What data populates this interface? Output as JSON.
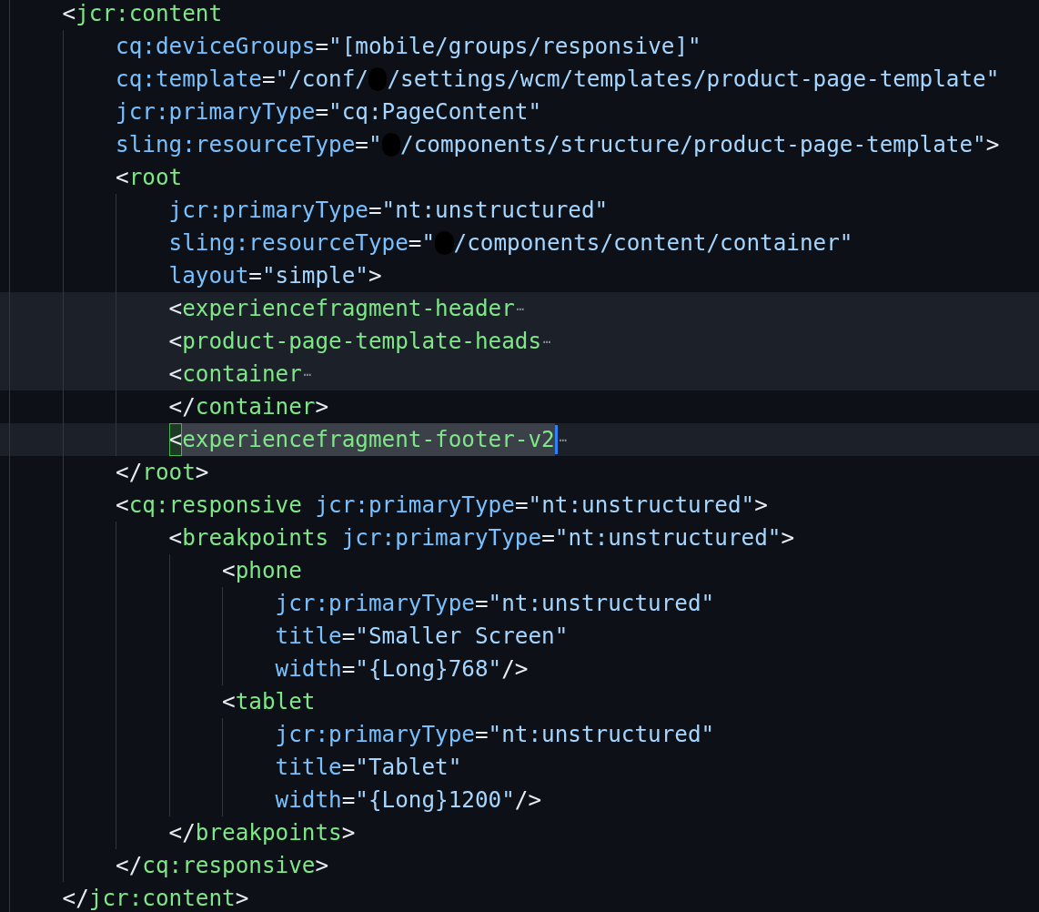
{
  "editor": {
    "lines": [
      {
        "highlighted": false,
        "tokens": [
          {
            "kind": "punct",
            "text": "<"
          },
          {
            "kind": "tag",
            "text": "jcr:content"
          }
        ],
        "children": [
          {
            "highlighted": false,
            "tokens": [
              {
                "kind": "attr",
                "text": "cq:deviceGroups"
              },
              {
                "kind": "punct",
                "text": "="
              },
              {
                "kind": "value",
                "text": "\"[mobile/groups/responsive]\""
              }
            ]
          },
          {
            "highlighted": false,
            "tokens": [
              {
                "kind": "attr",
                "text": "cq:template"
              },
              {
                "kind": "punct",
                "text": "="
              },
              {
                "kind": "value",
                "text": "\"/conf/"
              },
              {
                "kind": "redacted"
              },
              {
                "kind": "value",
                "text": "/settings/wcm/templates/product-page-template\""
              }
            ]
          },
          {
            "highlighted": false,
            "tokens": [
              {
                "kind": "attr",
                "text": "jcr:primaryType"
              },
              {
                "kind": "punct",
                "text": "="
              },
              {
                "kind": "value",
                "text": "\"cq:PageContent\""
              }
            ]
          },
          {
            "highlighted": false,
            "tokens": [
              {
                "kind": "attr",
                "text": "sling:resourceType"
              },
              {
                "kind": "punct",
                "text": "="
              },
              {
                "kind": "value",
                "text": "\""
              },
              {
                "kind": "redacted"
              },
              {
                "kind": "value",
                "text": "/components/structure/product-page-template\""
              },
              {
                "kind": "punct",
                "text": ">"
              }
            ]
          },
          {
            "highlighted": false,
            "tokens": [
              {
                "kind": "punct",
                "text": "<"
              },
              {
                "kind": "tag",
                "text": "root"
              }
            ],
            "children": [
              {
                "highlighted": false,
                "tokens": [
                  {
                    "kind": "attr",
                    "text": "jcr:primaryType"
                  },
                  {
                    "kind": "punct",
                    "text": "="
                  },
                  {
                    "kind": "value",
                    "text": "\"nt:unstructured\""
                  }
                ]
              },
              {
                "highlighted": false,
                "tokens": [
                  {
                    "kind": "attr",
                    "text": "sling:resourceType"
                  },
                  {
                    "kind": "punct",
                    "text": "="
                  },
                  {
                    "kind": "value",
                    "text": "\""
                  },
                  {
                    "kind": "redacted"
                  },
                  {
                    "kind": "value",
                    "text": "/components/content/container\""
                  }
                ]
              },
              {
                "highlighted": false,
                "tokens": [
                  {
                    "kind": "attr",
                    "text": "layout"
                  },
                  {
                    "kind": "punct",
                    "text": "="
                  },
                  {
                    "kind": "value",
                    "text": "\"simple\""
                  },
                  {
                    "kind": "punct",
                    "text": ">"
                  }
                ]
              },
              {
                "highlighted": true,
                "tokens": [
                  {
                    "kind": "punct",
                    "text": "<"
                  },
                  {
                    "kind": "tag",
                    "text": "experiencefragment-header"
                  },
                  {
                    "kind": "fold",
                    "text": "⋯"
                  }
                ]
              },
              {
                "highlighted": true,
                "tokens": [
                  {
                    "kind": "punct",
                    "text": "<"
                  },
                  {
                    "kind": "tag",
                    "text": "product-page-template-heads"
                  },
                  {
                    "kind": "fold",
                    "text": "⋯"
                  }
                ]
              },
              {
                "highlighted": true,
                "tokens": [
                  {
                    "kind": "punct",
                    "text": "<"
                  },
                  {
                    "kind": "tag",
                    "text": "container"
                  },
                  {
                    "kind": "fold",
                    "text": "⋯"
                  }
                ]
              },
              {
                "highlighted": false,
                "tokens": [
                  {
                    "kind": "punct",
                    "text": "</"
                  },
                  {
                    "kind": "tag",
                    "text": "container"
                  },
                  {
                    "kind": "punct",
                    "text": ">"
                  }
                ]
              },
              {
                "highlighted": true,
                "tokens": [
                  {
                    "kind": "match",
                    "text": "<"
                  },
                  {
                    "kind": "selection",
                    "text": "experiencefragment-footer-v2"
                  },
                  {
                    "kind": "cursor"
                  },
                  {
                    "kind": "fold",
                    "text": "⋯"
                  }
                ]
              }
            ]
          },
          {
            "highlighted": false,
            "tokens": [
              {
                "kind": "punct",
                "text": "</"
              },
              {
                "kind": "tag",
                "text": "root"
              },
              {
                "kind": "punct",
                "text": ">"
              }
            ]
          },
          {
            "highlighted": false,
            "tokens": [
              {
                "kind": "punct",
                "text": "<"
              },
              {
                "kind": "tag",
                "text": "cq:responsive"
              },
              {
                "kind": "attr",
                "text": " jcr:primaryType"
              },
              {
                "kind": "punct",
                "text": "="
              },
              {
                "kind": "value",
                "text": "\"nt:unstructured\""
              },
              {
                "kind": "punct",
                "text": ">"
              }
            ],
            "children": [
              {
                "highlighted": false,
                "tokens": [
                  {
                    "kind": "punct",
                    "text": "<"
                  },
                  {
                    "kind": "tag",
                    "text": "breakpoints"
                  },
                  {
                    "kind": "attr",
                    "text": " jcr:primaryType"
                  },
                  {
                    "kind": "punct",
                    "text": "="
                  },
                  {
                    "kind": "value",
                    "text": "\"nt:unstructured\""
                  },
                  {
                    "kind": "punct",
                    "text": ">"
                  }
                ],
                "children": [
                  {
                    "highlighted": false,
                    "tokens": [
                      {
                        "kind": "punct",
                        "text": "<"
                      },
                      {
                        "kind": "tag",
                        "text": "phone"
                      }
                    ],
                    "children": [
                      {
                        "highlighted": false,
                        "tokens": [
                          {
                            "kind": "attr",
                            "text": "jcr:primaryType"
                          },
                          {
                            "kind": "punct",
                            "text": "="
                          },
                          {
                            "kind": "value",
                            "text": "\"nt:unstructured\""
                          }
                        ]
                      },
                      {
                        "highlighted": false,
                        "tokens": [
                          {
                            "kind": "attr",
                            "text": "title"
                          },
                          {
                            "kind": "punct",
                            "text": "="
                          },
                          {
                            "kind": "value",
                            "text": "\"Smaller Screen\""
                          }
                        ]
                      },
                      {
                        "highlighted": false,
                        "tokens": [
                          {
                            "kind": "attr",
                            "text": "width"
                          },
                          {
                            "kind": "punct",
                            "text": "="
                          },
                          {
                            "kind": "value",
                            "text": "\"{Long}768\""
                          },
                          {
                            "kind": "punct",
                            "text": "/>"
                          }
                        ]
                      }
                    ]
                  },
                  {
                    "highlighted": false,
                    "tokens": [
                      {
                        "kind": "punct",
                        "text": "<"
                      },
                      {
                        "kind": "tag",
                        "text": "tablet"
                      }
                    ],
                    "children": [
                      {
                        "highlighted": false,
                        "tokens": [
                          {
                            "kind": "attr",
                            "text": "jcr:primaryType"
                          },
                          {
                            "kind": "punct",
                            "text": "="
                          },
                          {
                            "kind": "value",
                            "text": "\"nt:unstructured\""
                          }
                        ]
                      },
                      {
                        "highlighted": false,
                        "tokens": [
                          {
                            "kind": "attr",
                            "text": "title"
                          },
                          {
                            "kind": "punct",
                            "text": "="
                          },
                          {
                            "kind": "value",
                            "text": "\"Tablet\""
                          }
                        ]
                      },
                      {
                        "highlighted": false,
                        "tokens": [
                          {
                            "kind": "attr",
                            "text": "width"
                          },
                          {
                            "kind": "punct",
                            "text": "="
                          },
                          {
                            "kind": "value",
                            "text": "\"{Long}1200\""
                          },
                          {
                            "kind": "punct",
                            "text": "/>"
                          }
                        ]
                      }
                    ]
                  }
                ]
              },
              {
                "highlighted": false,
                "tokens": [
                  {
                    "kind": "punct",
                    "text": "</"
                  },
                  {
                    "kind": "tag",
                    "text": "breakpoints"
                  },
                  {
                    "kind": "punct",
                    "text": ">"
                  }
                ]
              }
            ]
          },
          {
            "highlighted": false,
            "tokens": [
              {
                "kind": "punct",
                "text": "</"
              },
              {
                "kind": "tag",
                "text": "cq:responsive"
              },
              {
                "kind": "punct",
                "text": ">"
              }
            ]
          }
        ]
      },
      {
        "highlighted": false,
        "tokens": [
          {
            "kind": "punct",
            "text": "</"
          },
          {
            "kind": "tag",
            "text": "jcr:content"
          },
          {
            "kind": "punct",
            "text": ">"
          }
        ]
      }
    ]
  }
}
